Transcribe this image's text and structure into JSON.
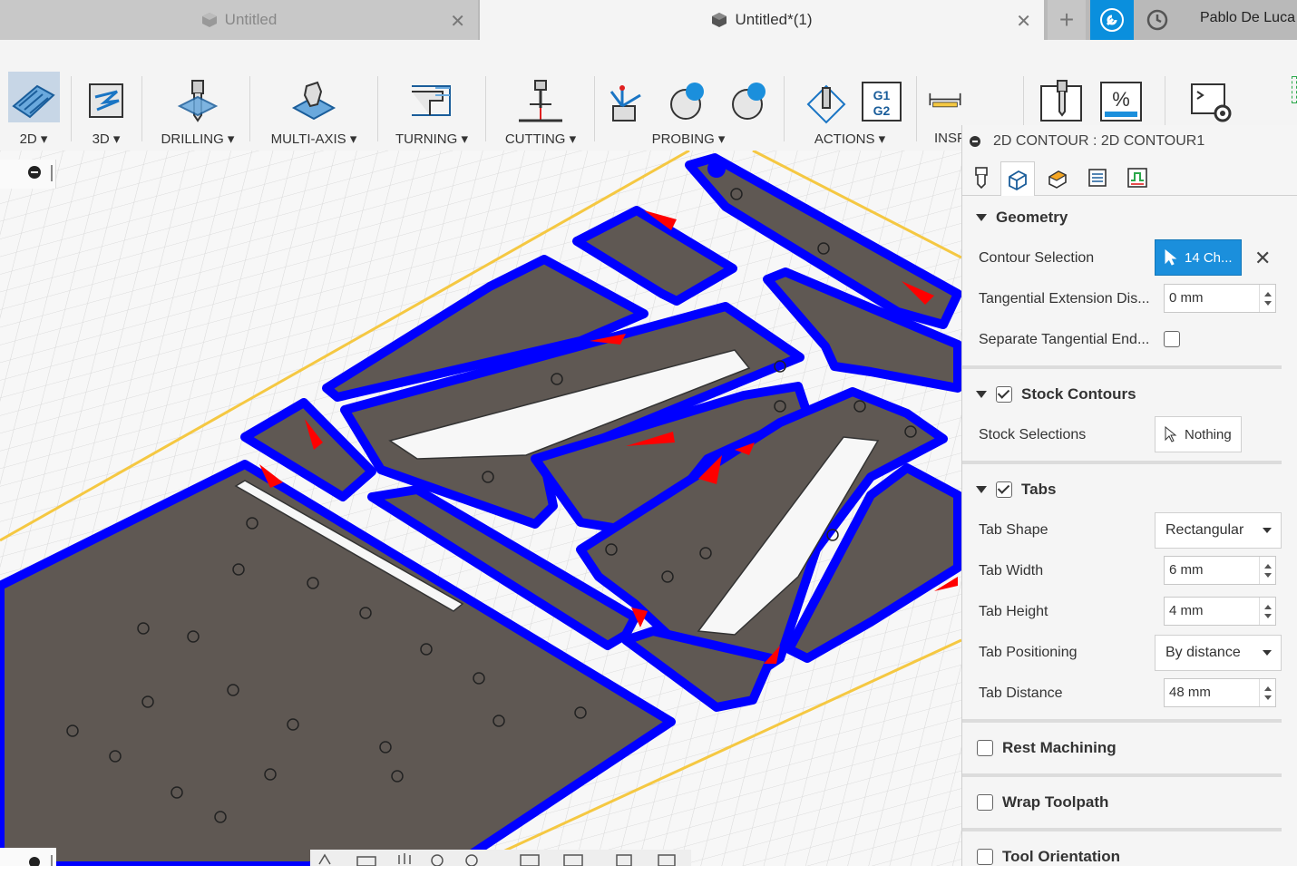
{
  "tabs": [
    {
      "label": "Untitled",
      "active": false
    },
    {
      "label": "Untitled*(1)",
      "active": true
    }
  ],
  "user": {
    "name": "Pablo De Luca"
  },
  "toolbar": {
    "groups": [
      {
        "label": "2D ▾",
        "icon": "2d-pocket-icon",
        "active": true
      },
      {
        "label": "3D ▾",
        "icon": "3d-adaptive-icon"
      },
      {
        "label": "DRILLING ▾",
        "icon": "drill-icon"
      },
      {
        "label": "MULTI-AXIS ▾",
        "icon": "multi-axis-icon"
      },
      {
        "label": "TURNING ▾",
        "icon": "turning-icon"
      },
      {
        "label": "CUTTING ▾",
        "icon": "cutting-icon"
      },
      {
        "label": "PROBING ▾",
        "icon": "probing-icon"
      },
      {
        "label": "ACTIONS ▾",
        "icon": "actions-icon"
      },
      {
        "label": "INSP",
        "icon": "inspect-icon"
      }
    ]
  },
  "panel": {
    "title": "2D CONTOUR : 2D CONTOUR1",
    "geometry": {
      "title": "Geometry",
      "contour_selection_label": "Contour Selection",
      "contour_selection_value": "14 Ch...",
      "tangential_ext_label": "Tangential Extension Dis...",
      "tangential_ext_value": "0 mm",
      "separate_tangential_label": "Separate Tangential End..."
    },
    "stock_contours": {
      "title": "Stock Contours",
      "stock_selections_label": "Stock Selections",
      "stock_selections_value": "Nothing"
    },
    "tabs": {
      "title": "Tabs",
      "shape_label": "Tab Shape",
      "shape_value": "Rectangular",
      "width_label": "Tab Width",
      "width_value": "6 mm",
      "height_label": "Tab Height",
      "height_value": "4 mm",
      "positioning_label": "Tab Positioning",
      "positioning_value": "By distance",
      "distance_label": "Tab Distance",
      "distance_value": "48 mm"
    },
    "rest_machining": {
      "title": "Rest Machining"
    },
    "wrap_toolpath": {
      "title": "Wrap Toolpath"
    },
    "tool_orientation": {
      "title": "Tool Orientation"
    }
  },
  "colors": {
    "accent": "#1b8fdc",
    "toolpath": "#0000ff",
    "stock": "#5f5853",
    "tab_marker": "#ff0000",
    "stock_box": "#f5c842"
  }
}
